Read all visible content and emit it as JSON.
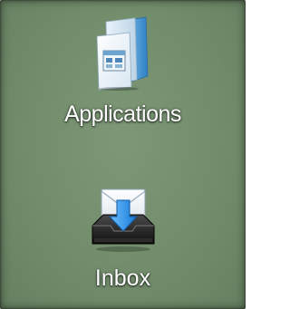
{
  "desktop": {
    "background_color": "#728d6c",
    "icons": [
      {
        "label": "Applications",
        "icon": "applications-folder-icon"
      },
      {
        "label": "Inbox",
        "icon": "inbox-tray-icon"
      }
    ]
  }
}
